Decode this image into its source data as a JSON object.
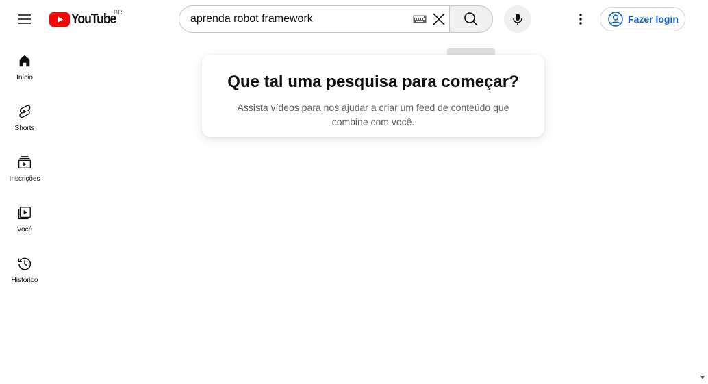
{
  "masthead": {
    "logo_text": "YouTube",
    "country_code": "BR",
    "search": {
      "value": "aprenda robot framework",
      "button_tooltip": "Pesquisar"
    },
    "login_label": "Fazer login"
  },
  "sidebar": {
    "items": [
      {
        "label": "Início",
        "icon": "home-icon"
      },
      {
        "label": "Shorts",
        "icon": "shorts-icon"
      },
      {
        "label": "Inscrições",
        "icon": "subscriptions-icon"
      },
      {
        "label": "Você",
        "icon": "you-icon"
      },
      {
        "label": "Histórico",
        "icon": "history-icon"
      }
    ]
  },
  "card": {
    "title": "Que tal uma pesquisa para começar?",
    "subtitle": "Assista vídeos para nos ajudar a criar um feed de conteúdo que combine com você."
  },
  "colors": {
    "brand_red": "#ff0000",
    "link_blue": "#065fd4",
    "text_primary": "#0f0f0f",
    "text_secondary": "#606060"
  }
}
